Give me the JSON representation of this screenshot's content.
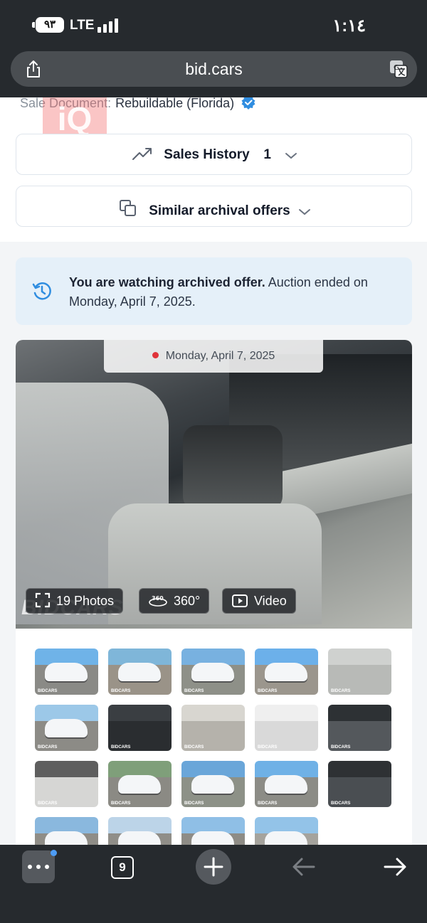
{
  "status_bar": {
    "battery": "٩٣",
    "network": "LTE",
    "time": "١:١٤"
  },
  "browser": {
    "url": "bid.cars",
    "tab_count": "9"
  },
  "listing": {
    "doc_label": "Sale Document:",
    "doc_value": "Rebuildable (Florida)",
    "watermark_logo": "iQ"
  },
  "sales_history": {
    "label": "Sales History",
    "count": "1"
  },
  "similar": {
    "label": "Similar archival offers"
  },
  "notice": {
    "bold": "You are watching archived offer.",
    "rest": " Auction ended on Monday, April 7, 2025."
  },
  "gallery": {
    "date": "Monday, April 7, 2025",
    "photo_watermark": "BIDCARS",
    "photos_label": "19 Photos",
    "view360_label": "360°",
    "video_label": "Video",
    "thumb_tag": "BIDCARS",
    "thumbnail_count": 19
  },
  "colors": {
    "accent": "#2f8de0",
    "notice_bg": "#e5f0f9",
    "status_dot": "#e0333a"
  }
}
